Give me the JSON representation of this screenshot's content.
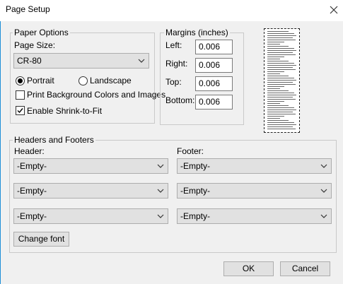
{
  "window": {
    "title": "Page Setup"
  },
  "paper_options": {
    "legend": "Paper Options",
    "page_size_label": "Page Size:",
    "page_size_value": "CR-80",
    "portrait_label": "Portrait",
    "landscape_label": "Landscape",
    "portrait_selected": true,
    "print_bg_label": "Print Background Colors and Images",
    "print_bg_checked": false,
    "shrink_label": "Enable Shrink-to-Fit",
    "shrink_checked": true
  },
  "margins": {
    "legend": "Margins (inches)",
    "left_label": "Left:",
    "left_value": "0.006",
    "right_label": "Right:",
    "right_value": "0.006",
    "top_label": "Top:",
    "top_value": "0.006",
    "bottom_label": "Bottom:",
    "bottom_value": "0.006"
  },
  "headers_footers": {
    "legend": "Headers and Footers",
    "header_label": "Header:",
    "footer_label": "Footer:",
    "header_values": [
      "-Empty-",
      "-Empty-",
      "-Empty-"
    ],
    "footer_values": [
      "-Empty-",
      "-Empty-",
      "-Empty-"
    ],
    "change_font_label": "Change font"
  },
  "buttons": {
    "ok_label": "OK",
    "cancel_label": "Cancel"
  },
  "icons": {
    "close": "close-icon",
    "dropdown": "chevron-down-icon",
    "check": "checkmark-icon"
  },
  "colors": {
    "window_accent": "#1e8fd8",
    "dialog_bg": "#f0f0f0",
    "button_bg": "#e1e1e1"
  }
}
